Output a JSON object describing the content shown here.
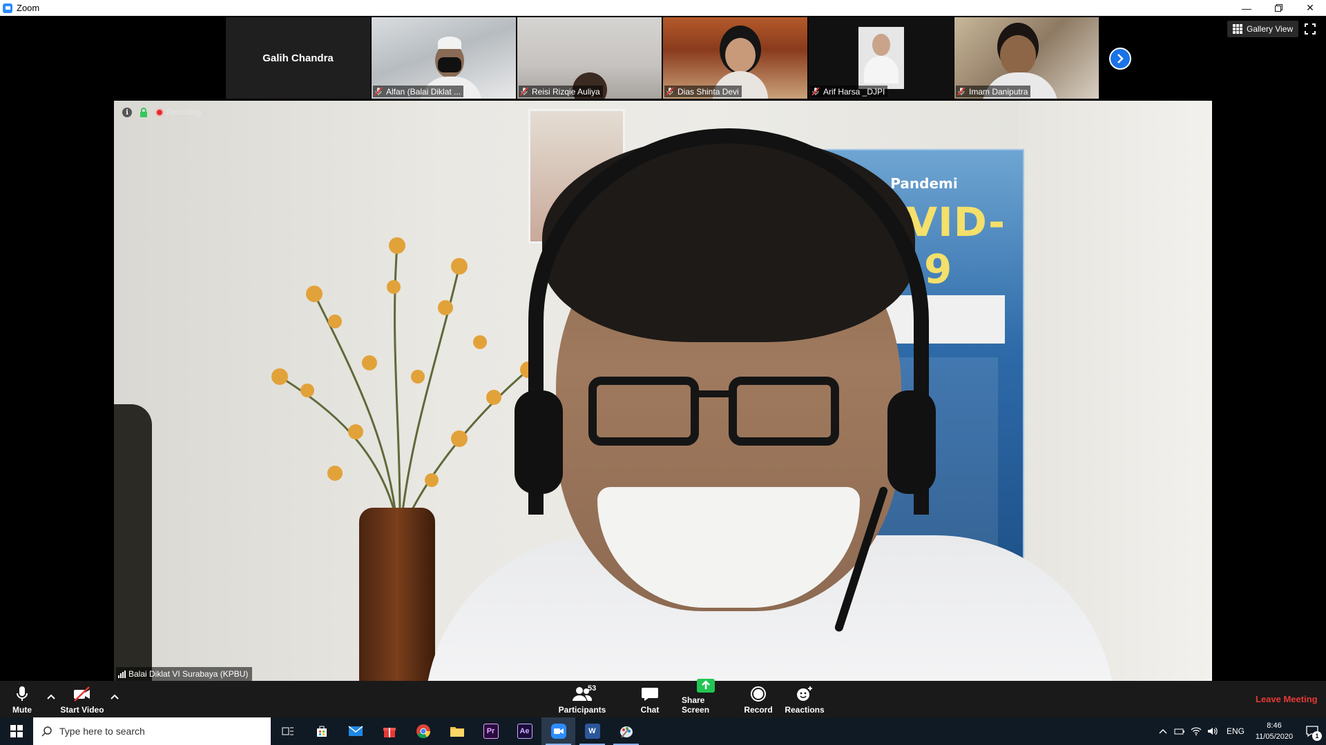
{
  "window": {
    "title": "Zoom"
  },
  "thumbnails": {
    "name_only": "Galih Chandra",
    "participants": [
      "Alfan (Balai Diklat ...",
      "Reisi Rizqie Auliya",
      "Dias Shinta Devi",
      "Arif Harsa _DJPI",
      "Imam Daniputra"
    ]
  },
  "view": {
    "gallery_label": "Gallery View"
  },
  "main": {
    "recording_label": "Recording",
    "speaker_name": "Balai Diklat VI Surabaya (KPBU)",
    "banner_title": "Pandemi",
    "banner_heading": "COVID-19"
  },
  "toolbar": {
    "mute_label": "Mute",
    "video_label": "Start Video",
    "participants_label": "Participants",
    "participants_count": "53",
    "chat_label": "Chat",
    "share_label": "Share Screen",
    "record_label": "Record",
    "reactions_label": "Reactions",
    "leave_label": "Leave Meeting"
  },
  "taskbar": {
    "search_placeholder": "Type here to search",
    "language": "ENG",
    "time": "8:46",
    "date": "11/05/2020",
    "notification_count": "1",
    "apps": [
      "task-view",
      "store",
      "mail",
      "gift",
      "chrome",
      "file-explorer",
      "premiere",
      "after-effects",
      "zoom",
      "word",
      "paint"
    ]
  },
  "colors": {
    "accent": "#2d8cff",
    "leave": "#e53935",
    "share": "#23c552"
  }
}
